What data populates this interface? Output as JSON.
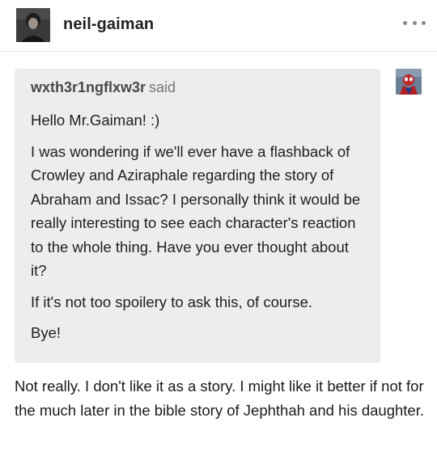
{
  "post": {
    "author": "neil-gaiman",
    "avatar_icon": "profile-photo-icon",
    "more_icon": "more-options-icon"
  },
  "ask": {
    "asker": "wxth3r1ngflxw3r",
    "said_label": "said",
    "asker_avatar_icon": "spiderman-avatar-icon",
    "paragraphs": [
      "Hello Mr.Gaiman! :)",
      "I was wondering if we'll ever have a flashback of Crowley and Aziraphale regarding the story of Abraham and Issac? I personally think it would be really interesting to see each character's reaction to the whole thing. Have you ever thought about it?",
      "If it's not too spoilery to ask this, of course.",
      "Bye!"
    ]
  },
  "answer": {
    "text": "Not really. I don't like it as a story. I might like it better if not for the much later in the bible story of Jephthah and his daughter."
  },
  "colors": {
    "ask_background": "#ededed",
    "asker_name": "#4a4a4a",
    "divider": "#e6e6e6"
  }
}
